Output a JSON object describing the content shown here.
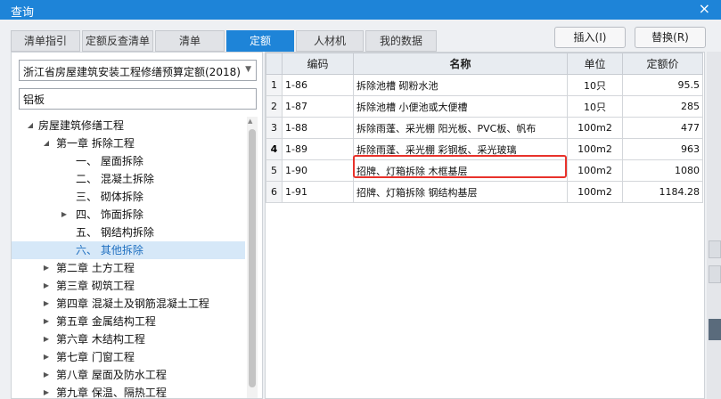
{
  "window": {
    "title": "查询",
    "close_glyph": "×"
  },
  "tabs": [
    {
      "label": "清单指引",
      "active": false
    },
    {
      "label": "定额反查清单",
      "active": false
    },
    {
      "label": "清单",
      "active": false
    },
    {
      "label": "定额",
      "active": true
    },
    {
      "label": "人材机",
      "active": false
    },
    {
      "label": "我的数据",
      "active": false
    }
  ],
  "buttons": {
    "insert": "插入(I)",
    "replace": "替换(R)"
  },
  "left_panel": {
    "dropdown_value": "浙江省房屋建筑安装工程修缮预算定额(2018)",
    "search_value": "铝板",
    "tree": [
      {
        "label": "房屋建筑修缮工程",
        "toggle": "◢",
        "selected": false
      },
      {
        "label": "第一章 拆除工程",
        "toggle": "◢",
        "selected": false
      },
      {
        "label": "一、 屋面拆除",
        "toggle": "",
        "selected": false
      },
      {
        "label": "二、 混凝土拆除",
        "toggle": "",
        "selected": false
      },
      {
        "label": "三、 砌体拆除",
        "toggle": "",
        "selected": false
      },
      {
        "label": "四、 饰面拆除",
        "toggle": "▶",
        "selected": false
      },
      {
        "label": "五、 钢结构拆除",
        "toggle": "",
        "selected": false
      },
      {
        "label": "六、 其他拆除",
        "toggle": "",
        "selected": true
      },
      {
        "label": "第二章 土方工程",
        "toggle": "▶",
        "selected": false
      },
      {
        "label": "第三章 砌筑工程",
        "toggle": "▶",
        "selected": false
      },
      {
        "label": "第四章 混凝土及钢筋混凝土工程",
        "toggle": "▶",
        "selected": false
      },
      {
        "label": "第五章 金属结构工程",
        "toggle": "▶",
        "selected": false
      },
      {
        "label": "第六章 木结构工程",
        "toggle": "▶",
        "selected": false
      },
      {
        "label": "第七章 门窗工程",
        "toggle": "▶",
        "selected": false
      },
      {
        "label": "第八章 屋面及防水工程",
        "toggle": "▶",
        "selected": false
      },
      {
        "label": "第九章 保温、隔热工程",
        "toggle": "▶",
        "selected": false
      }
    ]
  },
  "table": {
    "headers": [
      "",
      "编码",
      "名称",
      "单位",
      "定额价"
    ],
    "current_row": 4,
    "rows": [
      {
        "no": "1",
        "code": "1-86",
        "name": "拆除池槽 砌粉水池",
        "unit": "10只",
        "price": "95.5"
      },
      {
        "no": "2",
        "code": "1-87",
        "name": "拆除池槽 小便池或大便槽",
        "unit": "10只",
        "price": "285"
      },
      {
        "no": "3",
        "code": "1-88",
        "name": "拆除雨蓬、采光棚 阳光板、PVC板、帆布",
        "unit": "100m2",
        "price": "477"
      },
      {
        "no": "4",
        "code": "1-89",
        "name": "拆除雨蓬、采光棚 彩钢板、采光玻璃",
        "unit": "100m2",
        "price": "963"
      },
      {
        "no": "5",
        "code": "1-90",
        "name": "招牌、灯箱拆除 木框基层",
        "unit": "100m2",
        "price": "1080"
      },
      {
        "no": "6",
        "code": "1-91",
        "name": "招牌、灯箱拆除 钢结构基层",
        "unit": "100m2",
        "price": "1184.28"
      }
    ]
  },
  "colors": {
    "accent": "#1e84d8",
    "highlight_border": "#e8322b",
    "selected_bg": "#d6e8f8"
  }
}
